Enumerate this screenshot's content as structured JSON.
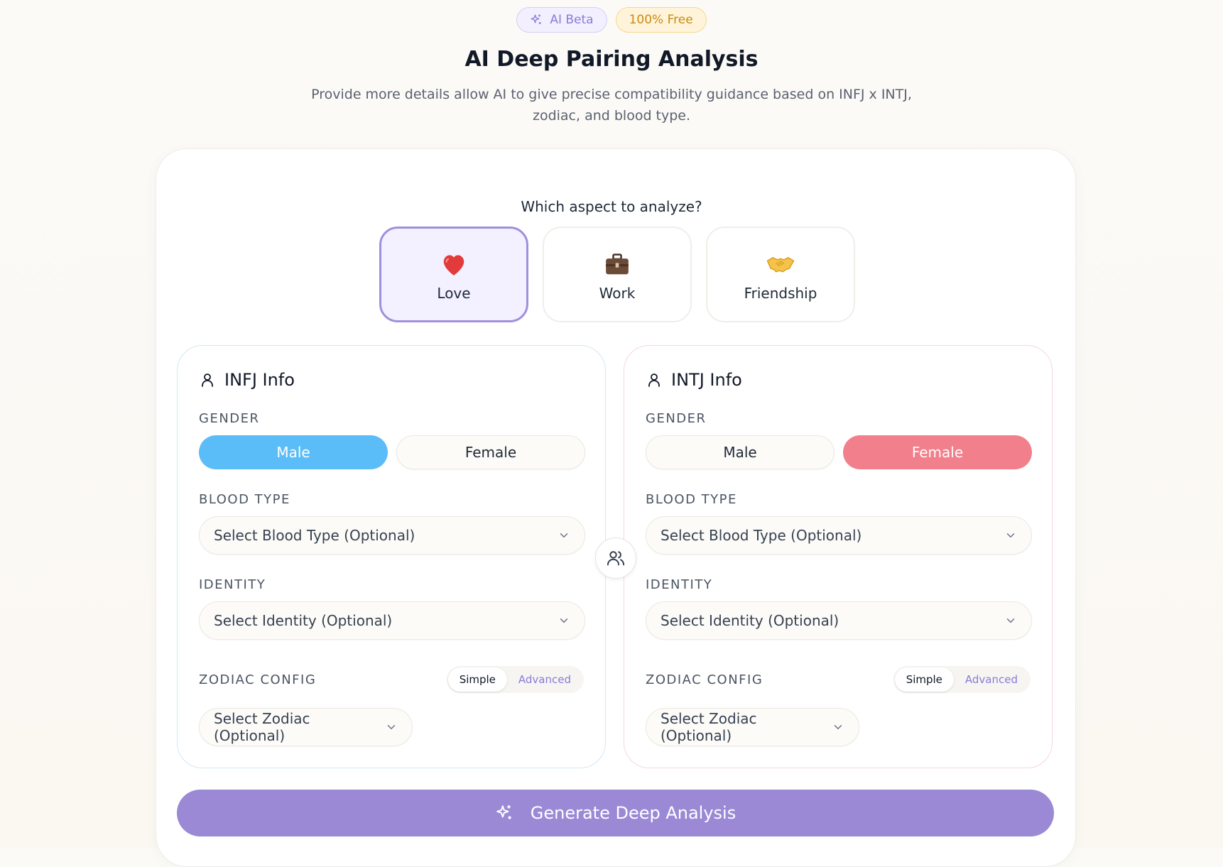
{
  "badges": {
    "ai": "AI Beta",
    "free": "100% Free"
  },
  "header": {
    "title": "AI Deep Pairing Analysis",
    "subtitle": "Provide more details allow AI to give precise compatibility guidance based on INFJ x INTJ, zodiac, and blood type."
  },
  "aspect": {
    "question": "Which aspect to analyze?",
    "options": [
      {
        "label": "Love",
        "icon": "heart-icon",
        "selected": true
      },
      {
        "label": "Work",
        "icon": "briefcase-icon",
        "selected": false
      },
      {
        "label": "Friendship",
        "icon": "handshake-icon",
        "selected": false
      }
    ]
  },
  "people": [
    {
      "title": "INFJ Info",
      "gender_label": "GENDER",
      "male": "Male",
      "female": "Female",
      "selected_gender": "Male",
      "blood_label": "BLOOD TYPE",
      "blood_placeholder": "Select Blood Type (Optional)",
      "identity_label": "IDENTITY",
      "identity_placeholder": "Select Identity (Optional)",
      "zodiac_label": "ZODIAC CONFIG",
      "zodiac_simple": "Simple",
      "zodiac_advanced": "Advanced",
      "zodiac_mode": "Simple",
      "zodiac_placeholder": "Select Zodiac (Optional)"
    },
    {
      "title": "INTJ Info",
      "gender_label": "GENDER",
      "male": "Male",
      "female": "Female",
      "selected_gender": "Female",
      "blood_label": "BLOOD TYPE",
      "blood_placeholder": "Select Blood Type (Optional)",
      "identity_label": "IDENTITY",
      "identity_placeholder": "Select Identity (Optional)",
      "zodiac_label": "ZODIAC CONFIG",
      "zodiac_simple": "Simple",
      "zodiac_advanced": "Advanced",
      "zodiac_mode": "Simple",
      "zodiac_placeholder": "Select Zodiac (Optional)"
    }
  ],
  "generate": {
    "label": "Generate Deep Analysis"
  },
  "colors": {
    "accent": "#9b89d6",
    "male": "#5bbdf7",
    "female": "#f27f8c",
    "badge_ai": "#8b7bd8",
    "badge_free": "#c98a12"
  }
}
